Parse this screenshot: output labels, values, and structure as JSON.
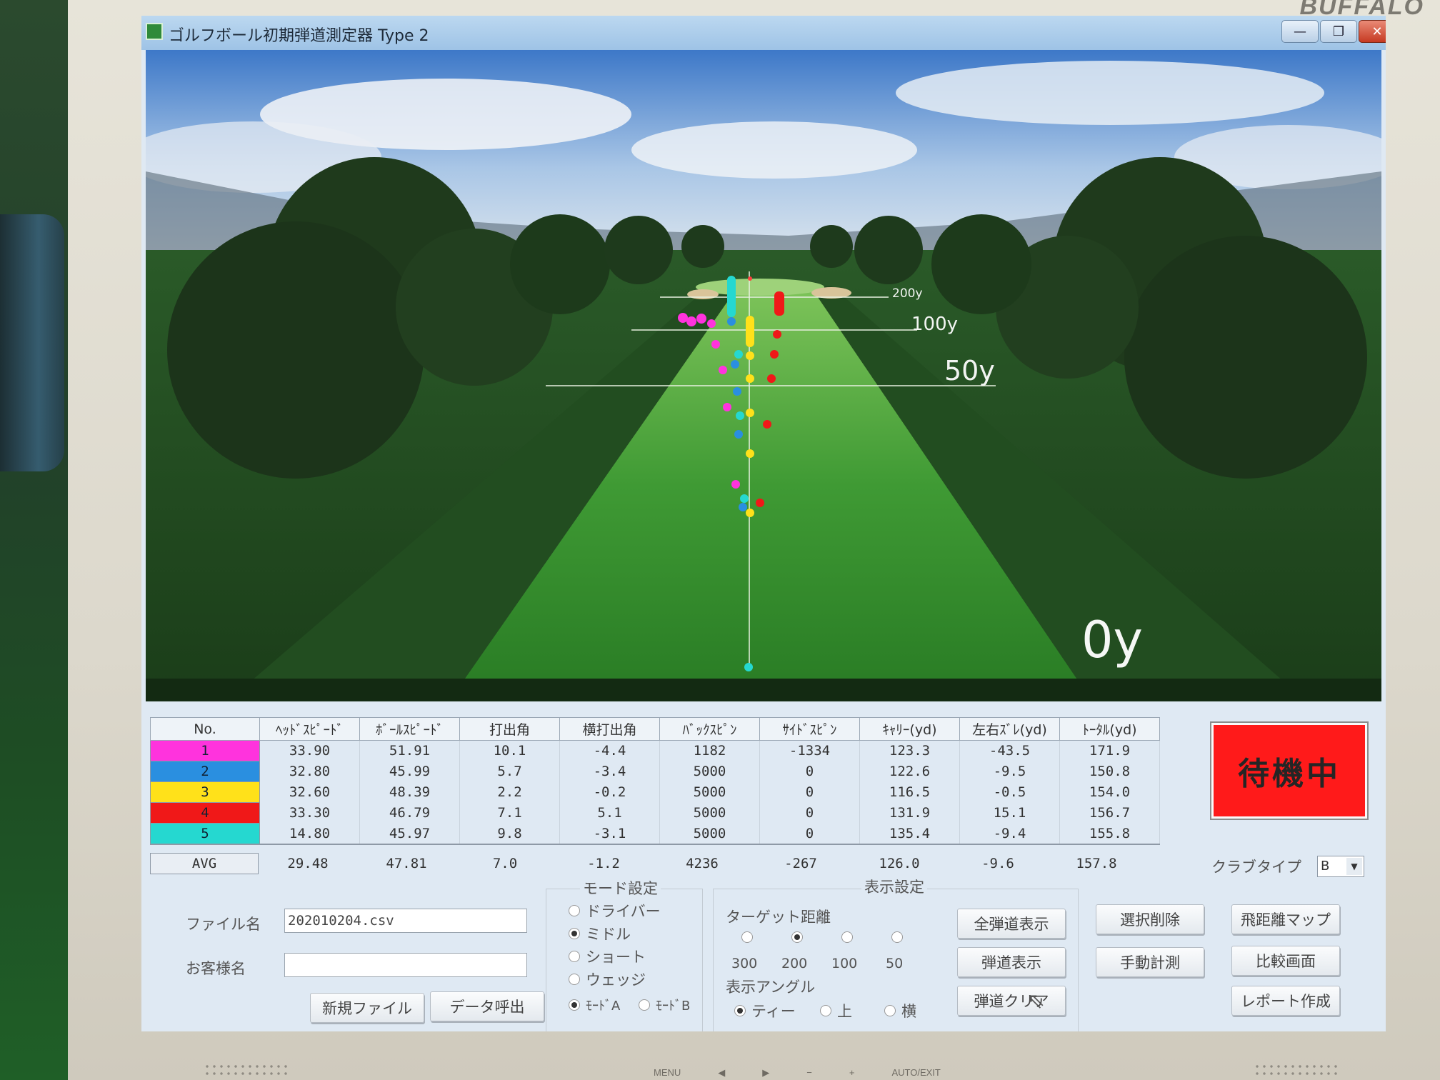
{
  "monitor": {
    "brand": "BUFFALO",
    "controls": [
      "MENU",
      "◀",
      "▶",
      "−",
      "+",
      "AUTO/EXIT"
    ]
  },
  "window": {
    "title": "ゴルフボール初期弾道測定器 Type 2",
    "buttons": [
      "—",
      "❐",
      "✕"
    ]
  },
  "view": {
    "distance_labels": [
      "200y",
      "100y",
      "50y",
      "0y"
    ]
  },
  "table": {
    "headers": [
      "No.",
      "ﾍｯﾄﾞｽﾋﾟｰﾄﾞ",
      "ﾎﾞｰﾙｽﾋﾟｰﾄﾞ",
      "打出角",
      "横打出角",
      "ﾊﾞｯｸｽﾋﾟﾝ",
      "ｻｲﾄﾞｽﾋﾟﾝ",
      "ｷｬﾘｰ(yd)",
      "左右ｽﾞﾚ(yd)",
      "ﾄｰﾀﾙ(yd)"
    ],
    "rows": [
      {
        "no": "1",
        "color": "#ff33dd",
        "cells": [
          "33.90",
          "51.91",
          "10.1",
          "-4.4",
          "1182",
          "-1334",
          "123.3",
          "-43.5",
          "171.9"
        ]
      },
      {
        "no": "2",
        "color": "#2a8fe0",
        "cells": [
          "32.80",
          "45.99",
          "5.7",
          "-3.4",
          "5000",
          "0",
          "122.6",
          "-9.5",
          "150.8"
        ]
      },
      {
        "no": "3",
        "color": "#ffe11a",
        "cells": [
          "32.60",
          "48.39",
          "2.2",
          "-0.2",
          "5000",
          "0",
          "116.5",
          "-0.5",
          "154.0"
        ]
      },
      {
        "no": "4",
        "color": "#f01818",
        "cells": [
          "33.30",
          "46.79",
          "7.1",
          "5.1",
          "5000",
          "0",
          "131.9",
          "15.1",
          "156.7"
        ]
      },
      {
        "no": "5",
        "color": "#25d8d0",
        "cells": [
          "14.80",
          "45.97",
          "9.8",
          "-3.1",
          "5000",
          "0",
          "135.4",
          "-9.4",
          "155.8"
        ]
      }
    ],
    "avg": {
      "label": "AVG",
      "cells": [
        "29.48",
        "47.81",
        "7.0",
        "-1.2",
        "4236",
        "-267",
        "126.0",
        "-9.6",
        "157.8"
      ]
    }
  },
  "status": {
    "text": "待機中",
    "color": "#ff1a1a"
  },
  "club_type": {
    "label": "クラブタイプ",
    "value": "B"
  },
  "file": {
    "file_label": "ファイル名",
    "file_value": "202010204.csv",
    "customer_label": "お客様名",
    "customer_value": "",
    "new_button": "新規ファイル",
    "load_button": "データ呼出"
  },
  "mode": {
    "title": "モード設定",
    "options": [
      "ドライバー",
      "ミドル",
      "ショート",
      "ウェッジ"
    ],
    "selected": "ミドル",
    "sub_options": [
      "ﾓｰﾄﾞA",
      "ﾓｰﾄﾞB"
    ],
    "sub_selected": "ﾓｰﾄﾞA"
  },
  "display": {
    "title": "表示設定",
    "target_label": "ターゲット距離",
    "targets": [
      "300",
      "200",
      "100",
      "50"
    ],
    "target_selected": "200",
    "angle_label": "表示アングル",
    "angles": [
      "ティー",
      "上",
      "横"
    ],
    "angle_selected": "ティー",
    "buttons": [
      "全弾道表示",
      "弾道表示",
      "弾道クリア"
    ]
  },
  "actions": {
    "buttons": [
      "選択削除",
      "飛距離マップ",
      "手動計測",
      "比較画面",
      "レポート作成"
    ]
  }
}
